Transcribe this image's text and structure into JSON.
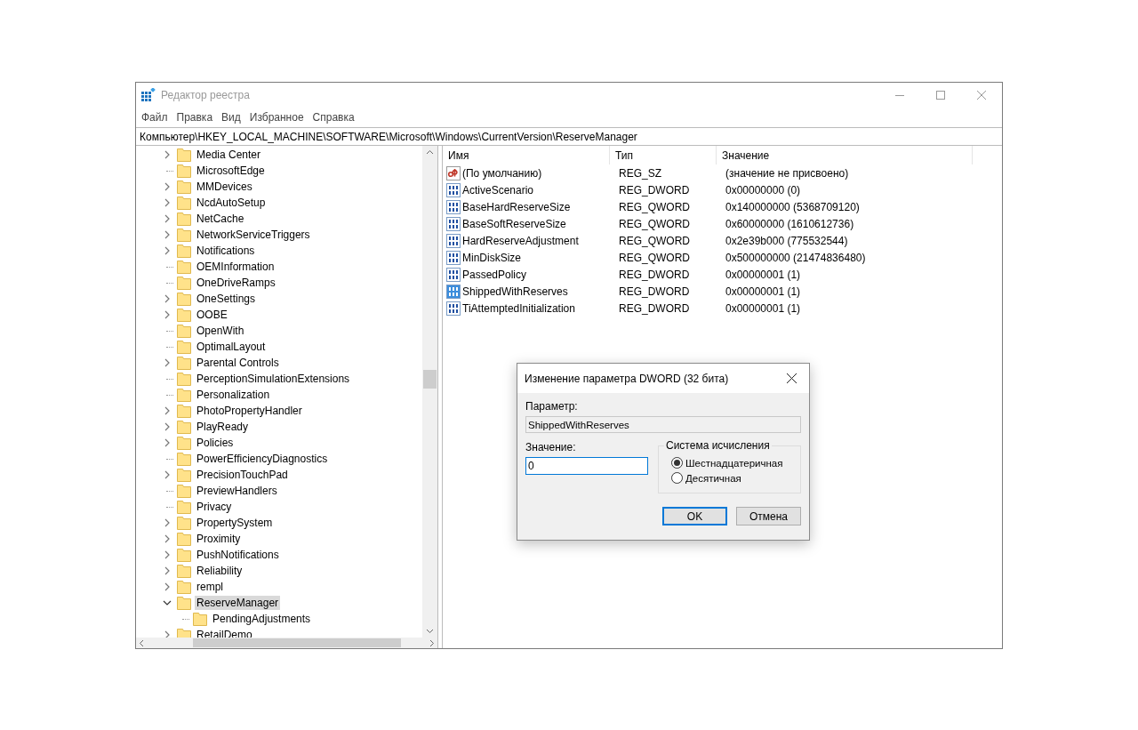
{
  "window": {
    "title": "Редактор реестра"
  },
  "menu": [
    "Файл",
    "Правка",
    "Вид",
    "Избранное",
    "Справка"
  ],
  "address": "Компьютер\\HKEY_LOCAL_MACHINE\\SOFTWARE\\Microsoft\\Windows\\CurrentVersion\\ReserveManager",
  "tree": [
    {
      "label": "Media Center",
      "has_children": true,
      "expanded": false,
      "selected": false
    },
    {
      "label": "MicrosoftEdge",
      "has_children": false,
      "selected": false
    },
    {
      "label": "MMDevices",
      "has_children": true,
      "expanded": false,
      "selected": false
    },
    {
      "label": "NcdAutoSetup",
      "has_children": true,
      "expanded": false,
      "selected": false
    },
    {
      "label": "NetCache",
      "has_children": true,
      "expanded": false,
      "selected": false
    },
    {
      "label": "NetworkServiceTriggers",
      "has_children": true,
      "expanded": false,
      "selected": false
    },
    {
      "label": "Notifications",
      "has_children": true,
      "expanded": false,
      "selected": false
    },
    {
      "label": "OEMInformation",
      "has_children": false,
      "selected": false
    },
    {
      "label": "OneDriveRamps",
      "has_children": false,
      "selected": false
    },
    {
      "label": "OneSettings",
      "has_children": true,
      "expanded": false,
      "selected": false
    },
    {
      "label": "OOBE",
      "has_children": true,
      "expanded": false,
      "selected": false
    },
    {
      "label": "OpenWith",
      "has_children": false,
      "selected": false
    },
    {
      "label": "OptimalLayout",
      "has_children": false,
      "selected": false
    },
    {
      "label": "Parental Controls",
      "has_children": true,
      "expanded": false,
      "selected": false
    },
    {
      "label": "PerceptionSimulationExtensions",
      "has_children": false,
      "selected": false
    },
    {
      "label": "Personalization",
      "has_children": false,
      "selected": false
    },
    {
      "label": "PhotoPropertyHandler",
      "has_children": true,
      "expanded": false,
      "selected": false
    },
    {
      "label": "PlayReady",
      "has_children": true,
      "expanded": false,
      "selected": false
    },
    {
      "label": "Policies",
      "has_children": true,
      "expanded": false,
      "selected": false
    },
    {
      "label": "PowerEfficiencyDiagnostics",
      "has_children": false,
      "selected": false
    },
    {
      "label": "PrecisionTouchPad",
      "has_children": true,
      "expanded": false,
      "selected": false
    },
    {
      "label": "PreviewHandlers",
      "has_children": false,
      "selected": false
    },
    {
      "label": "Privacy",
      "has_children": false,
      "selected": false
    },
    {
      "label": "PropertySystem",
      "has_children": true,
      "expanded": false,
      "selected": false
    },
    {
      "label": "Proximity",
      "has_children": true,
      "expanded": false,
      "selected": false
    },
    {
      "label": "PushNotifications",
      "has_children": true,
      "expanded": false,
      "selected": false
    },
    {
      "label": "Reliability",
      "has_children": true,
      "expanded": false,
      "selected": false
    },
    {
      "label": "rempl",
      "has_children": true,
      "expanded": false,
      "selected": false
    },
    {
      "label": "ReserveManager",
      "has_children": true,
      "expanded": true,
      "selected": true,
      "children": [
        {
          "label": "PendingAdjustments",
          "has_children": false,
          "selected": false
        }
      ]
    },
    {
      "label": "RetailDemo",
      "has_children": true,
      "expanded": false,
      "selected": false
    }
  ],
  "table": {
    "columns": [
      "Имя",
      "Тип",
      "Значение"
    ],
    "rows": [
      {
        "kind": "string",
        "name": "(По умолчанию)",
        "type": "REG_SZ",
        "value": "(значение не присвоено)",
        "selected": false
      },
      {
        "kind": "binary",
        "name": "ActiveScenario",
        "type": "REG_DWORD",
        "value": "0x00000000 (0)",
        "selected": false
      },
      {
        "kind": "binary",
        "name": "BaseHardReserveSize",
        "type": "REG_QWORD",
        "value": "0x140000000 (5368709120)",
        "selected": false
      },
      {
        "kind": "binary",
        "name": "BaseSoftReserveSize",
        "type": "REG_QWORD",
        "value": "0x60000000 (1610612736)",
        "selected": false
      },
      {
        "kind": "binary",
        "name": "HardReserveAdjustment",
        "type": "REG_QWORD",
        "value": "0x2e39b000 (775532544)",
        "selected": false
      },
      {
        "kind": "binary",
        "name": "MinDiskSize",
        "type": "REG_QWORD",
        "value": "0x500000000 (21474836480)",
        "selected": false
      },
      {
        "kind": "binary",
        "name": "PassedPolicy",
        "type": "REG_DWORD",
        "value": "0x00000001 (1)",
        "selected": false
      },
      {
        "kind": "binary",
        "name": "ShippedWithReserves",
        "type": "REG_DWORD",
        "value": "0x00000001 (1)",
        "selected": true
      },
      {
        "kind": "binary",
        "name": "TiAttemptedInitialization",
        "type": "REG_DWORD",
        "value": "0x00000001 (1)",
        "selected": false
      }
    ]
  },
  "dialog": {
    "title": "Изменение параметра DWORD (32 бита)",
    "param_label": "Параметр:",
    "param_value": "ShippedWithReserves",
    "value_label": "Значение:",
    "value": "0",
    "base_group": "Система исчисления",
    "base_options": [
      {
        "label": "Шестнадцатеричная",
        "selected": true
      },
      {
        "label": "Десятичная",
        "selected": false
      }
    ],
    "buttons": [
      {
        "label": "OK",
        "default": true
      },
      {
        "label": "Отмена",
        "default": false
      }
    ]
  }
}
